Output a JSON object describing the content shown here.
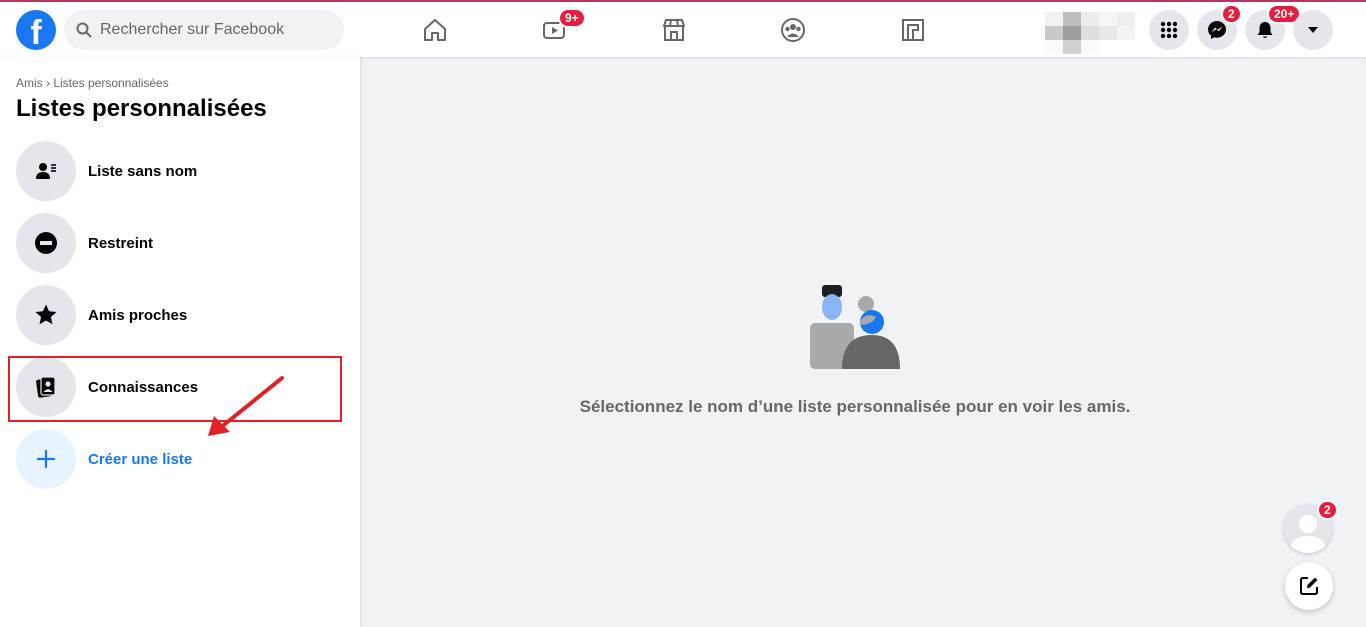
{
  "header": {
    "logo_text": "f",
    "search": {
      "placeholder": "Rechercher sur Facebook"
    },
    "nav": [
      {
        "name": "home",
        "icon": "home-icon",
        "badge": ""
      },
      {
        "name": "watch",
        "icon": "video-icon",
        "badge": "9+"
      },
      {
        "name": "marketplace",
        "icon": "store-icon",
        "badge": ""
      },
      {
        "name": "groups",
        "icon": "groups-icon",
        "badge": ""
      },
      {
        "name": "gaming",
        "icon": "gaming-icon",
        "badge": ""
      }
    ],
    "messenger_badge": "2",
    "notifications_badge": "20+"
  },
  "sidebar": {
    "breadcrumb": "Amis › Listes personnalisées",
    "title": "Listes personnalisées",
    "items": [
      {
        "label": "Liste sans nom",
        "icon": "contact-card-icon"
      },
      {
        "label": "Restreint",
        "icon": "restricted-icon"
      },
      {
        "label": "Amis proches",
        "icon": "star-icon"
      },
      {
        "label": "Connaissances",
        "icon": "acquaintances-icon"
      },
      {
        "label": "Créer une liste",
        "icon": "plus-icon"
      }
    ]
  },
  "main": {
    "empty_message": "Sélectionnez le nom d’une liste personnalisée pour en voir les amis."
  },
  "chat": {
    "badge": "2"
  },
  "colors": {
    "brand": "#1877f2",
    "badge": "#e41e3f",
    "annotation": "#e02226",
    "background": "#f0f2f5"
  }
}
